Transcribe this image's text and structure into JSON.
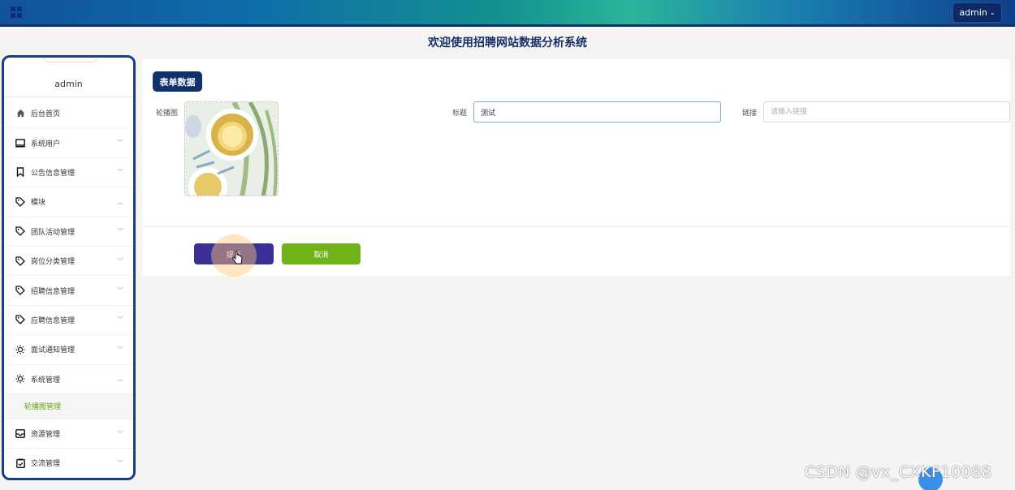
{
  "topbar": {
    "user_label": "admin"
  },
  "page_title": "欢迎使用招聘网站数据分析系统",
  "sidebar": {
    "username": "admin",
    "items": [
      {
        "label": "后台首页",
        "icon": "home-icon",
        "arrow": ""
      },
      {
        "label": "系统用户",
        "icon": "monitor-icon",
        "arrow": "down"
      },
      {
        "label": "公告信息管理",
        "icon": "bookmark-icon",
        "arrow": "down"
      },
      {
        "label": "模块",
        "icon": "tag-icon",
        "arrow": "up"
      },
      {
        "label": "团队活动管理",
        "icon": "tag-icon",
        "arrow": "down"
      },
      {
        "label": "岗位分类管理",
        "icon": "tag-icon",
        "arrow": "down"
      },
      {
        "label": "招聘信息管理",
        "icon": "tag-icon",
        "arrow": "down"
      },
      {
        "label": "应聘信息管理",
        "icon": "tag-icon",
        "arrow": "down"
      },
      {
        "label": "面试通知管理",
        "icon": "sun-icon",
        "arrow": "down"
      },
      {
        "label": "系统管理",
        "icon": "sun-icon",
        "arrow": "up"
      },
      {
        "label": "轮播图管理",
        "icon": "",
        "arrow": "",
        "sub": true
      },
      {
        "label": "资源管理",
        "icon": "inbox-icon",
        "arrow": "down"
      },
      {
        "label": "交流管理",
        "icon": "clipboard-icon",
        "arrow": "down"
      }
    ]
  },
  "form": {
    "tag": "表单数据",
    "image_label": "轮播图",
    "title_label": "标题",
    "title_value": "测试",
    "link_label": "链接",
    "link_placeholder": "请输入链接",
    "submit_label": "提交",
    "cancel_label": "取消"
  },
  "watermark": "CSDN @vx_CXKF10088",
  "colors": {
    "accent": "#11306e",
    "submit": "#3b3195",
    "cancel": "#70b318",
    "sub_active": "#6ba218"
  }
}
